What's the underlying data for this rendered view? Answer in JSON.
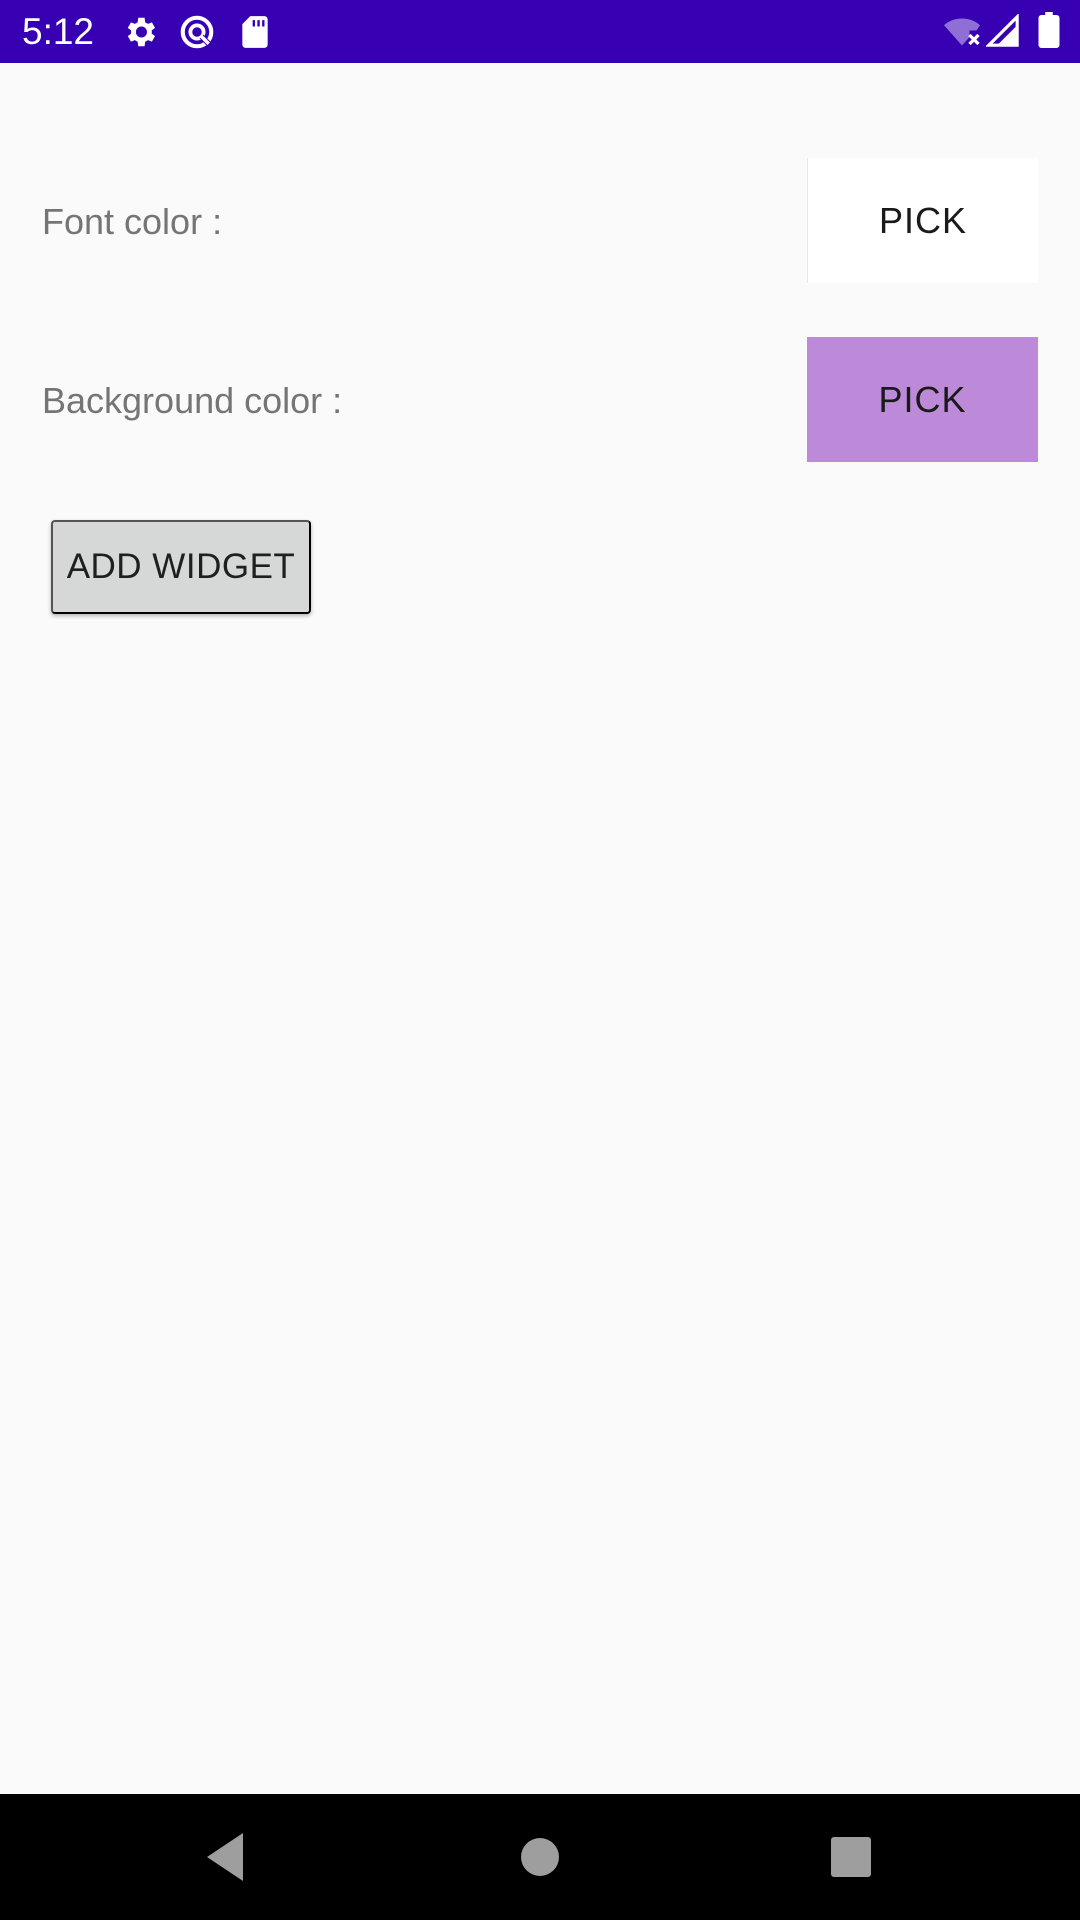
{
  "status_bar": {
    "time": "5:12",
    "background_color": "#3700b3",
    "icons": [
      "gear-icon",
      "sync-icon",
      "sd-card-icon",
      "wifi-off-icon",
      "signal-icon",
      "battery-icon"
    ]
  },
  "main": {
    "font_color_row": {
      "label": "Font color :",
      "button_label": "PICK",
      "selected_color": "#ffffff"
    },
    "background_color_row": {
      "label": "Background color :",
      "button_label": "PICK",
      "selected_color": "#bc8ad8"
    },
    "add_widget_button": {
      "label": "ADD WIDGET"
    }
  },
  "nav_bar": {
    "icons": [
      "back-icon",
      "home-icon",
      "recents-icon"
    ]
  }
}
